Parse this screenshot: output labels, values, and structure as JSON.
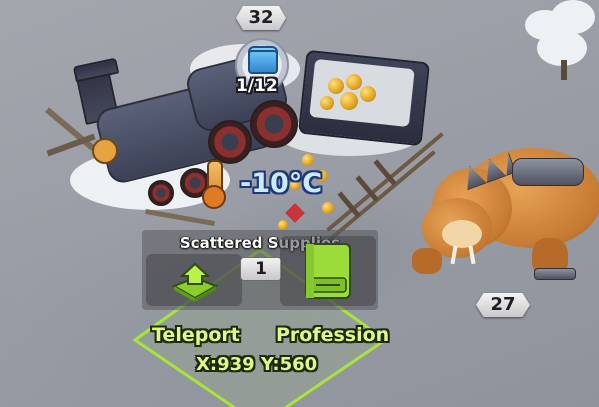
{
  "map": {
    "target_level": "32",
    "beast_level": "27",
    "chest_progress": "1/12",
    "temperature": "-10°C"
  },
  "action_panel": {
    "title": "Scattered Supplies",
    "count": "1",
    "teleport_label": "Teleport",
    "profession_label": "Profession"
  },
  "location": {
    "coordinates": "X:939 Y:560"
  },
  "icons": {
    "teleport": "teleport-arrow-icon",
    "profession": "profession-book-icon",
    "chest": "supply-chest-icon",
    "temperature": "thermometer-icon"
  },
  "colors": {
    "accent_green": "#a6e63a",
    "label_green": "#dff98a",
    "temp_blue": "#cfe8ff"
  }
}
